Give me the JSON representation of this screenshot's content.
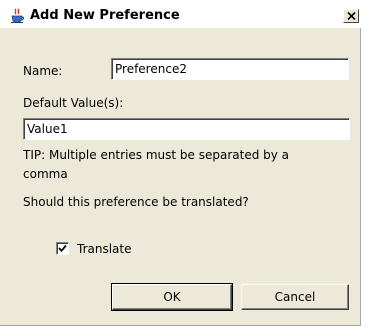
{
  "window": {
    "title": "Add New Preference",
    "icon": "java-cup-icon",
    "close_label": "close"
  },
  "form": {
    "name_label": "Name:",
    "name_value": "Preference2",
    "default_values_label": "Default Value(s):",
    "default_values_value": "Value1",
    "tip_line1": "TIP: Multiple entries must be separated by a",
    "tip_line2": "comma",
    "question": "Should this preference be translated?",
    "translate_label": "Translate",
    "translate_checked": true
  },
  "buttons": {
    "ok_label": "OK",
    "cancel_label": "Cancel"
  },
  "colors": {
    "dialog_background": "#ece9d8",
    "titlebar_background": "#ffffff",
    "field_background": "#ffffff"
  }
}
